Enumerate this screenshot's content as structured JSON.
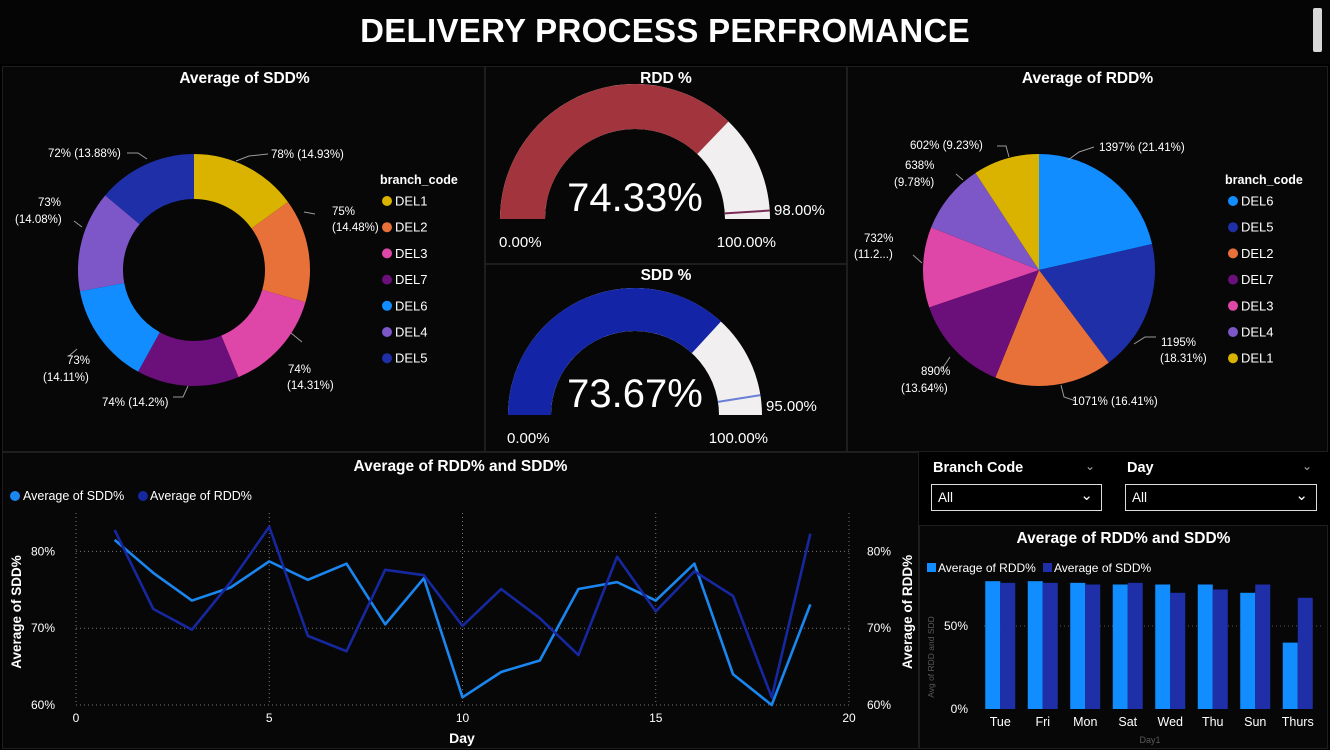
{
  "title": "DELIVERY PROCESS PERFROMANCE",
  "colors": {
    "DEL1": "#d9b300",
    "DEL2": "#e8713a",
    "DEL3": "#de47a8",
    "DEL7": "#6b0f7a",
    "DEL6": "#118dff",
    "DEL4": "#7d56c8",
    "DEL5": "#1e2fa8",
    "sdd_line": "#1a86f0",
    "rdd_line": "#1628a0",
    "gauge_rdd": "#a1343c",
    "gauge_sdd": "#1325a6",
    "gauge_track": "#f1efef"
  },
  "sdd_donut": {
    "title": "Average of SDD%",
    "legend_title": "branch_code",
    "legend": [
      "DEL1",
      "DEL2",
      "DEL3",
      "DEL7",
      "DEL6",
      "DEL4",
      "DEL5"
    ],
    "labels": {
      "DEL1": "78% (14.93%)",
      "DEL2_a": "75%",
      "DEL2_b": "(14.48%)",
      "DEL3_a": "74%",
      "DEL3_b": "(14.31%)",
      "DEL7": "74% (14.2%)",
      "DEL6_a": "73%",
      "DEL6_b": "(14.11%)",
      "DEL4_a": "73%",
      "DEL4_b": "(14.08%)",
      "DEL5": "72% (13.88%)"
    }
  },
  "rdd_gauge": {
    "title": "RDD %",
    "value_label": "74.33%",
    "min_label": "0.00%",
    "max_label": "100.00%",
    "target_label": "98.00%"
  },
  "sdd_gauge": {
    "title": "SDD %",
    "value_label": "73.67%",
    "min_label": "0.00%",
    "max_label": "100.00%",
    "target_label": "95.00%"
  },
  "rdd_pie": {
    "title": "Average of RDD%",
    "legend_title": "branch_code",
    "legend": [
      "DEL6",
      "DEL5",
      "DEL2",
      "DEL7",
      "DEL3",
      "DEL4",
      "DEL1"
    ],
    "labels": {
      "DEL6": "1397% (21.41%)",
      "DEL5_a": "1195%",
      "DEL5_b": "(18.31%)",
      "DEL2": "1071% (16.41%)",
      "DEL7_a": "890%",
      "DEL7_b": "(13.64%)",
      "DEL3_a": "732%",
      "DEL3_b": "(11.2...)",
      "DEL4_a": "638%",
      "DEL4_b": "(9.78%)",
      "DEL1": "602% (9.23%)"
    }
  },
  "line_panel": {
    "title": "Average of RDD% and SDD%",
    "legend_sdd": "Average of SDD%",
    "legend_rdd": "Average of RDD%",
    "xlabel": "Day",
    "ylabel_left": "Average of SDD%",
    "ylabel_right": "Average of RDD%"
  },
  "slicers": {
    "branch": {
      "label": "Branch Code",
      "value": "All"
    },
    "day": {
      "label": "Day",
      "value": "All"
    }
  },
  "bar_panel": {
    "title": "Average of RDD% and SDD%",
    "legend_rdd": "Average of RDD%",
    "legend_sdd": "Average of SDD%",
    "ylabel": "Avg of RDD and SDD",
    "xlabel": "Day1"
  },
  "chart_data": [
    {
      "type": "pie",
      "title": "Average of SDD%",
      "categories": [
        "DEL1",
        "DEL2",
        "DEL3",
        "DEL7",
        "DEL6",
        "DEL4",
        "DEL5"
      ],
      "values": [
        78,
        75,
        74,
        74,
        73,
        73,
        72
      ],
      "shares": [
        14.93,
        14.48,
        14.31,
        14.2,
        14.11,
        14.08,
        13.88
      ],
      "donut": true,
      "legend_position": "right"
    },
    {
      "type": "pie",
      "title": "Average of RDD%",
      "categories": [
        "DEL6",
        "DEL5",
        "DEL2",
        "DEL7",
        "DEL3",
        "DEL4",
        "DEL1"
      ],
      "values": [
        1397,
        1195,
        1071,
        890,
        732,
        638,
        602
      ],
      "shares": [
        21.41,
        18.31,
        16.41,
        13.64,
        11.2,
        9.78,
        9.23
      ],
      "legend_position": "right"
    },
    {
      "type": "line",
      "title": "Average of RDD% and SDD%",
      "xlabel": "Day",
      "ylabel": "Average of SDD%",
      "ylabel_right": "Average of RDD%",
      "x": [
        1,
        2,
        3,
        4,
        5,
        6,
        7,
        8,
        9,
        10,
        11,
        12,
        13,
        14,
        15,
        16,
        17,
        18,
        19
      ],
      "xlim": [
        0,
        20
      ],
      "xticks": [
        0,
        5,
        10,
        15,
        20
      ],
      "ylim": [
        60,
        85
      ],
      "yticks": [
        "60%",
        "70%",
        "80%"
      ],
      "grid": true,
      "legend_position": "top-left",
      "series": [
        {
          "name": "Average of SDD%",
          "axis": "left",
          "values": [
            81.5,
            77.2,
            73.6,
            75.3,
            78.7,
            76.3,
            78.4,
            70.5,
            76.5,
            61,
            64.3,
            65.8,
            75.1,
            76,
            73.6,
            78.4,
            64,
            60,
            73.1
          ]
        },
        {
          "name": "Average of RDD%",
          "axis": "right",
          "values": [
            82.8,
            72.5,
            69.8,
            76,
            83.2,
            69,
            67,
            77.6,
            76.9,
            70.3,
            75.1,
            71.3,
            66.5,
            79.3,
            72.2,
            77.4,
            74.2,
            61,
            82.3
          ]
        }
      ]
    },
    {
      "type": "bar",
      "title": "Average of RDD% and SDD%",
      "xlabel": "Day1",
      "ylabel": "Avg of RDD and SDD",
      "categories": [
        "Tue",
        "Fri",
        "Mon",
        "Sat",
        "Wed",
        "Thu",
        "Sun",
        "Thurs"
      ],
      "ylim": [
        0,
        100
      ],
      "yticks": [
        "0%",
        "50%"
      ],
      "legend_position": "top-left",
      "series": [
        {
          "name": "Average of RDD%",
          "values": [
            77,
            77,
            76,
            75,
            75,
            75,
            70,
            40
          ]
        },
        {
          "name": "Average of SDD%",
          "values": [
            76,
            76,
            75,
            76,
            70,
            72,
            75,
            67
          ]
        }
      ]
    }
  ]
}
